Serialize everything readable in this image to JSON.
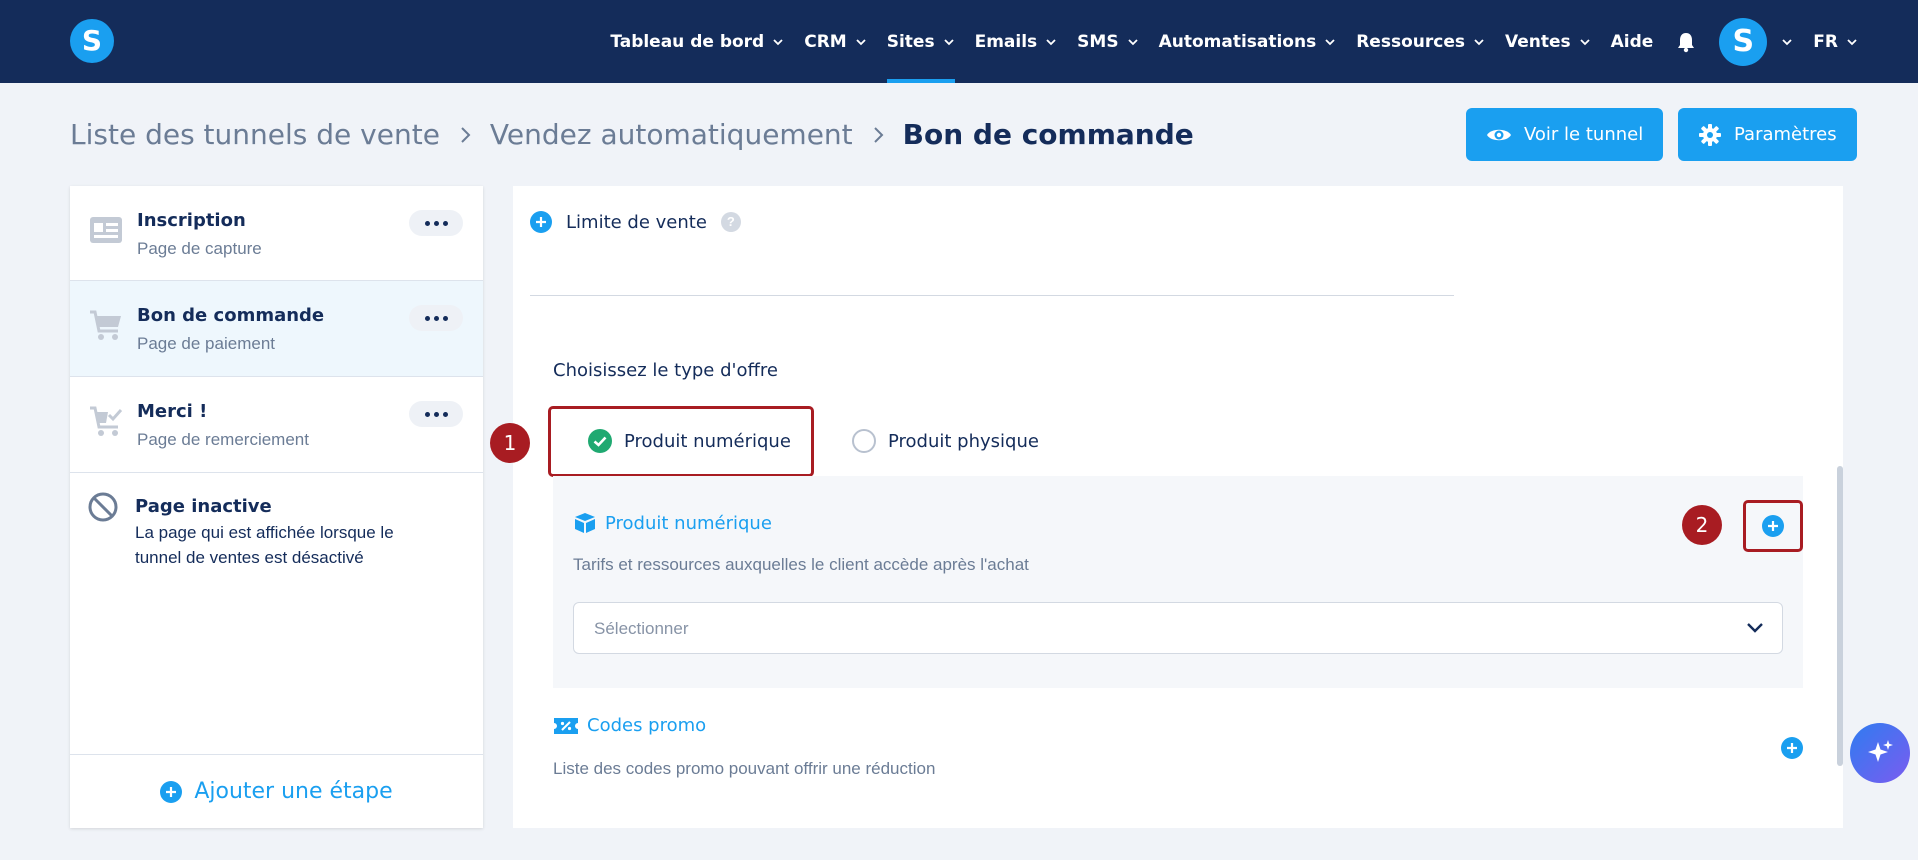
{
  "nav": {
    "logo_letter": "S",
    "items": [
      {
        "label": "Tableau de bord"
      },
      {
        "label": "CRM"
      },
      {
        "label": "Sites"
      },
      {
        "label": "Emails"
      },
      {
        "label": "SMS"
      },
      {
        "label": "Automatisations"
      },
      {
        "label": "Ressources"
      },
      {
        "label": "Ventes"
      }
    ],
    "help": "Aide",
    "avatar_letter": "S",
    "language": "FR",
    "active_item": "Sites"
  },
  "breadcrumb": {
    "items": [
      "Liste des tunnels de vente",
      "Vendez automatiquement",
      "Bon de commande"
    ]
  },
  "actions": {
    "view_funnel": "Voir le tunnel",
    "settings": "Paramètres"
  },
  "sidebar": {
    "steps": [
      {
        "title": "Inscription",
        "subtitle": "Page de capture",
        "icon": "form-page-icon"
      },
      {
        "title": "Bon de commande",
        "subtitle": "Page de paiement",
        "icon": "cart-icon"
      },
      {
        "title": "Merci !",
        "subtitle": "Page de remerciement",
        "icon": "cart-check-icon"
      }
    ],
    "inactive": {
      "title": "Page inactive",
      "description_line1": "La page qui est affichée lorsque le",
      "description_line2": "tunnel de ventes est désactivé"
    },
    "add_step": "Ajouter une étape"
  },
  "main": {
    "sale_limit": "Limite de vente",
    "offer_type_label": "Choisissez le type d'offre",
    "options": {
      "digital": "Produit numérique",
      "physical": "Produit physique"
    },
    "selected_option": "digital",
    "product_section": {
      "title": "Produit numérique",
      "description": "Tarifs et ressources auxquelles le client accède après l'achat",
      "select_placeholder": "Sélectionner"
    },
    "promo_section": {
      "title": "Codes promo",
      "description": "Liste des codes promo pouvant offrir une réduction"
    }
  },
  "callouts": {
    "first": "1",
    "second": "2"
  },
  "colors": {
    "nav_bg": "#142c5a",
    "accent": "#1a9ff0",
    "callout_red": "#a81c22",
    "success_green": "#1fa971"
  }
}
